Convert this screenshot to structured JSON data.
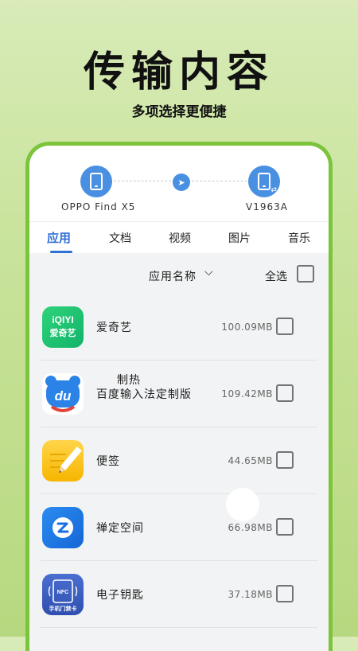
{
  "hero": {
    "title": "传输内容",
    "subtitle": "多项选择更便捷"
  },
  "devices": {
    "source": "OPPO Find X5",
    "target": "V1963A"
  },
  "tabs": [
    "应用",
    "文档",
    "视频",
    "图片",
    "音乐"
  ],
  "list_header": {
    "sort_label": "应用名称",
    "select_all": "全选"
  },
  "apps": [
    {
      "name": "爱奇艺",
      "size": "100.09MB",
      "icon_text": "iQIYI",
      "icon_sub": "爱奇艺"
    },
    {
      "name_top": "制热",
      "name": "百度输入法定制版",
      "size": "109.42MB",
      "icon_text": "du"
    },
    {
      "name": "便签",
      "size": "44.65MB"
    },
    {
      "name": "禅定空间",
      "size": "66.98MB"
    },
    {
      "name": "电子钥匙",
      "size": "37.18MB",
      "icon_text": "NFC",
      "icon_sub": "手机门禁卡"
    }
  ],
  "colors": {
    "accent": "#2f6fd6",
    "frame": "#7cc43c",
    "device": "#4a90e2"
  }
}
